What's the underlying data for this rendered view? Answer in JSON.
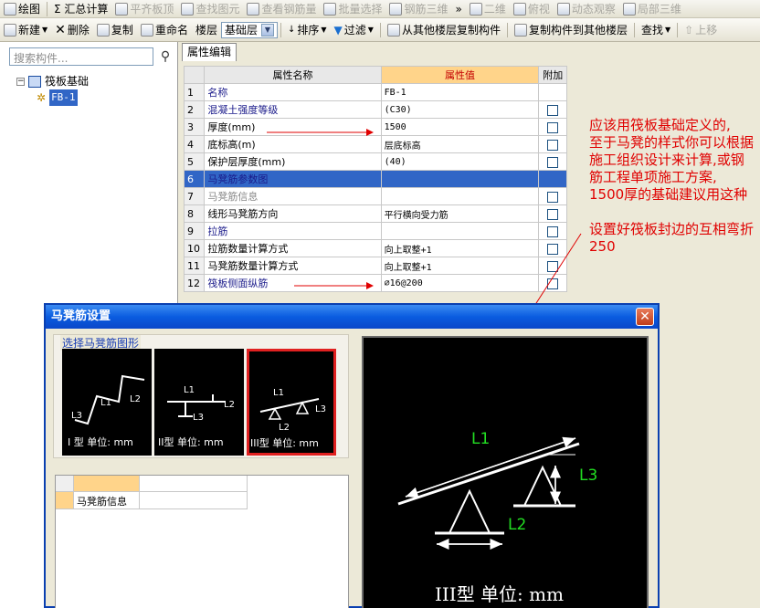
{
  "toolbar1": {
    "items": [
      {
        "label": "绘图",
        "disabled": false
      },
      {
        "label": "Σ 汇总计算",
        "disabled": false
      },
      {
        "label": "平齐板顶",
        "disabled": true
      },
      {
        "label": "查找图元",
        "disabled": true
      },
      {
        "label": "查看钢筋量",
        "disabled": true
      },
      {
        "label": "批量选择",
        "disabled": true
      },
      {
        "label": "钢筋三维",
        "disabled": true
      },
      {
        "label": "»",
        "disabled": false
      },
      {
        "label": "二维",
        "disabled": true
      },
      {
        "label": "俯视",
        "disabled": true
      },
      {
        "label": "动态观察",
        "disabled": true
      },
      {
        "label": "局部三维",
        "disabled": true
      }
    ]
  },
  "toolbar2": {
    "new_label": "新建",
    "delete_label": "删除",
    "copy_label": "复制",
    "rename_label": "重命名",
    "floor_label": "楼层",
    "floor_value": "基础层",
    "sort_label": "排序",
    "filter_label": "过滤",
    "copy_from_label": "从其他楼层复制构件",
    "copy_to_label": "复制构件到其他楼层",
    "find_label": "查找",
    "up_label": "上移"
  },
  "left_panel": {
    "search_placeholder": "搜索构件...",
    "tree_root": "筏板基础",
    "tree_child": "FB-1"
  },
  "tab_label": "属性编辑",
  "property_table": {
    "headers": [
      "属性名称",
      "属性值",
      "附加"
    ],
    "rows": [
      {
        "num": "1",
        "name": "名称",
        "value": "FB-1",
        "checkbox": false,
        "style": "blue"
      },
      {
        "num": "2",
        "name": "混凝土强度等级",
        "value": "(C30)",
        "checkbox": true,
        "style": "blue"
      },
      {
        "num": "3",
        "name": "厚度(mm)",
        "value": "1500",
        "checkbox": true,
        "style": "black"
      },
      {
        "num": "4",
        "name": "底标高(m)",
        "value": "层底标高",
        "checkbox": true,
        "style": "black"
      },
      {
        "num": "5",
        "name": "保护层厚度(mm)",
        "value": "(40)",
        "checkbox": true,
        "style": "black"
      },
      {
        "num": "6",
        "name": "马凳筋参数图",
        "value": "",
        "checkbox": false,
        "style": "selected"
      },
      {
        "num": "7",
        "name": "马凳筋信息",
        "value": "",
        "checkbox": true,
        "style": "gray"
      },
      {
        "num": "8",
        "name": "线形马凳筋方向",
        "value": "平行横向受力筋",
        "checkbox": true,
        "style": "black"
      },
      {
        "num": "9",
        "name": "拉筋",
        "value": "",
        "checkbox": true,
        "style": "blue"
      },
      {
        "num": "10",
        "name": "拉筋数量计算方式",
        "value": "向上取整+1",
        "checkbox": true,
        "style": "black"
      },
      {
        "num": "11",
        "name": "马凳筋数量计算方式",
        "value": "向上取整+1",
        "checkbox": true,
        "style": "black"
      },
      {
        "num": "12",
        "name": "筏板侧面纵筋",
        "value": "⌀16@200",
        "checkbox": true,
        "style": "blue"
      }
    ]
  },
  "annotation": {
    "line1": "应该用筏板基础定义的,",
    "line2": "至于马凳的样式你可以根据施工组织设计来计算,或钢筋工程单项施工方案,",
    "line3": "1500厚的基础建议用这种",
    "line4": "设置好筏板封边的互相弯折250",
    "color": "#e00000"
  },
  "dialog": {
    "title": "马凳筋设置",
    "close_label": "✕",
    "group_label": "选择马凳筋图形",
    "thumbs": [
      {
        "caption": "I 型 单位: mm",
        "l1": "L1",
        "l2": "L2",
        "l3": "L3"
      },
      {
        "caption": "II型 单位: mm",
        "l1": "L1",
        "l2": "L2",
        "l3": "L3"
      },
      {
        "caption": "III型 单位: mm",
        "l1": "L1",
        "l2": "L2",
        "l3": "L3"
      }
    ],
    "info_label": "马凳筋信息",
    "preview": {
      "l1": "L1",
      "l2": "L2",
      "l3": "L3",
      "caption": "III型  单位: mm",
      "label_color": "#22dd22"
    }
  }
}
